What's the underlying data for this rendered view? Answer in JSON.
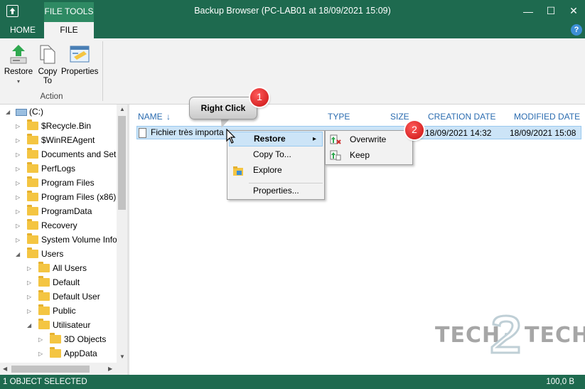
{
  "window": {
    "title": "Backup Browser (PC-LAB01 at 18/09/2021 15:09)",
    "contextual_tab": "FILE TOOLS",
    "controls": {
      "minimize": "—",
      "maximize": "☐",
      "close": "✕"
    }
  },
  "tabs": {
    "home": "HOME",
    "file": "FILE",
    "help": "?"
  },
  "ribbon": {
    "restore_label": "Restore",
    "restore_arrow": "▾",
    "copy_to_label_line1": "Copy",
    "copy_to_label_line2": "To",
    "properties_label": "Properties",
    "group_label": "Action"
  },
  "tree": {
    "root": "(C:)",
    "items": [
      {
        "label": "$Recycle.Bin"
      },
      {
        "label": "$WinREAgent"
      },
      {
        "label": "Documents and Set"
      },
      {
        "label": "PerfLogs"
      },
      {
        "label": "Program Files"
      },
      {
        "label": "Program Files (x86)"
      },
      {
        "label": "ProgramData"
      },
      {
        "label": "Recovery"
      },
      {
        "label": "System Volume Info"
      },
      {
        "label": "Users"
      },
      {
        "label": "All Users"
      },
      {
        "label": "Default"
      },
      {
        "label": "Default User"
      },
      {
        "label": "Public"
      },
      {
        "label": "Utilisateur"
      },
      {
        "label": "3D Objects"
      },
      {
        "label": "AppData"
      }
    ]
  },
  "file_list": {
    "columns": {
      "name": "NAME",
      "type": "TYPE",
      "size": "SIZE",
      "creation_date": "CREATION DATE",
      "modified_date": "MODIFIED DATE"
    },
    "sort_indicator": "↓",
    "rows": [
      {
        "name": "Fichier très importa",
        "creation_date": "18/09/2021 14:32",
        "modified_date": "18/09/2021 15:08"
      }
    ]
  },
  "context_menu": {
    "items": [
      {
        "label": "Restore"
      },
      {
        "label": "Copy To..."
      },
      {
        "label": "Explore"
      },
      {
        "label": "Properties..."
      }
    ],
    "submenu_arrow": "▸",
    "submenu": [
      {
        "label": "Overwrite"
      },
      {
        "label": "Keep"
      }
    ]
  },
  "annotations": {
    "callout_text": "Right Click",
    "badge_1": "1",
    "badge_2": "2"
  },
  "watermark": {
    "left": "TECH",
    "right": "TECH"
  },
  "status_bar": {
    "selection": "1 OBJECT SELECTED",
    "size": "100,0 B"
  },
  "colors": {
    "accent": "#1e6a4f",
    "selection": "#cce4f7",
    "link_header": "#2b6cb0",
    "folder": "#f4c542"
  }
}
